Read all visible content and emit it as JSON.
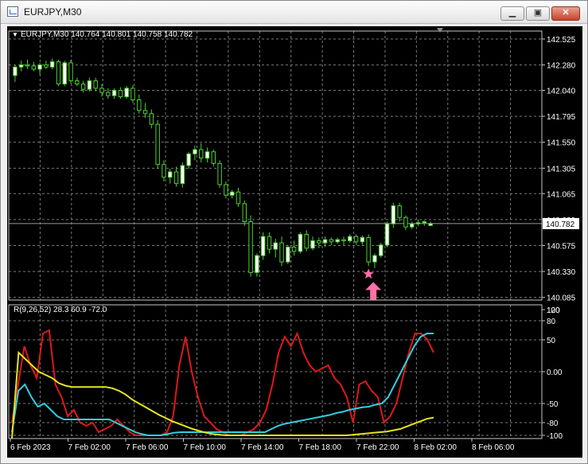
{
  "window": {
    "title": "EURJPY,M30",
    "minimize_icon": "minimize-icon",
    "maximize_icon": "maximize-icon",
    "close_icon": "close-icon"
  },
  "colors": {
    "background": "#000000",
    "grid": "#7a7a7a",
    "bull": "#ffffff",
    "bear": "#ffffff",
    "wick": "#4cd12e",
    "rsi_fast": "#e01818",
    "rsi_mid": "#2fd0e0",
    "rsi_slow": "#e6e61e",
    "signal": "#ff6fa8",
    "price_line": "#9a9a9a"
  },
  "chart_data": [
    {
      "type": "candlestick",
      "title": "EURJPY,M30  140.764 140.801 140.758 140.782",
      "symbol_label": "EURJPY,M30",
      "ohlc_label": "140.764 140.801 140.758 140.782",
      "ylim": [
        140.06,
        142.6
      ],
      "y_ticks": [
        "142.525",
        "142.280",
        "142.040",
        "141.795",
        "141.550",
        "141.305",
        "141.065",
        "140.820",
        "140.575",
        "140.330",
        "140.085"
      ],
      "current_price": "140.782",
      "current_value": 140.782,
      "x_labels": [
        "6 Feb 2023",
        "7 Feb 02:00",
        "7 Feb 06:00",
        "7 Feb 10:00",
        "7 Feb 14:00",
        "7 Feb 18:00",
        "7 Feb 22:00",
        "8 Feb 02:00",
        "8 Feb 06:00"
      ],
      "candles": [
        [
          142.18,
          142.28,
          142.12,
          142.26
        ],
        [
          142.26,
          142.32,
          142.22,
          142.28
        ],
        [
          142.28,
          142.33,
          142.24,
          142.27
        ],
        [
          142.27,
          142.31,
          142.22,
          142.24
        ],
        [
          142.24,
          142.3,
          142.19,
          142.28
        ],
        [
          142.28,
          142.32,
          142.24,
          142.26
        ],
        [
          142.26,
          142.34,
          142.24,
          142.31
        ],
        [
          142.31,
          142.33,
          142.08,
          142.1
        ],
        [
          142.1,
          142.32,
          142.08,
          142.3
        ],
        [
          142.3,
          142.33,
          142.1,
          142.13
        ],
        [
          142.13,
          142.16,
          142.08,
          142.1
        ],
        [
          142.1,
          142.13,
          142.02,
          142.05
        ],
        [
          142.05,
          142.16,
          142.03,
          142.13
        ],
        [
          142.13,
          142.16,
          142.03,
          142.06
        ],
        [
          142.06,
          142.1,
          141.98,
          142.02
        ],
        [
          142.02,
          142.06,
          141.96,
          141.99
        ],
        [
          141.99,
          142.06,
          141.96,
          142.04
        ],
        [
          142.04,
          142.07,
          141.96,
          141.98
        ],
        [
          141.98,
          142.08,
          141.96,
          142.06
        ],
        [
          142.06,
          142.09,
          141.92,
          141.95
        ],
        [
          141.95,
          142.0,
          141.82,
          141.85
        ],
        [
          141.85,
          141.92,
          141.78,
          141.82
        ],
        [
          141.82,
          141.86,
          141.68,
          141.72
        ],
        [
          141.72,
          141.76,
          141.3,
          141.34
        ],
        [
          141.34,
          141.38,
          141.18,
          141.22
        ],
        [
          141.22,
          141.3,
          141.16,
          141.27
        ],
        [
          141.27,
          141.32,
          141.13,
          141.16
        ],
        [
          141.16,
          141.36,
          141.12,
          141.33
        ],
        [
          141.33,
          141.46,
          141.3,
          141.44
        ],
        [
          141.44,
          141.52,
          141.38,
          141.48
        ],
        [
          141.48,
          141.54,
          141.36,
          141.4
        ],
        [
          141.4,
          141.5,
          141.36,
          141.46
        ],
        [
          141.46,
          141.48,
          141.32,
          141.35
        ],
        [
          141.35,
          141.38,
          141.12,
          141.15
        ],
        [
          141.15,
          141.18,
          141.02,
          141.05
        ],
        [
          141.05,
          141.1,
          141.02,
          141.08
        ],
        [
          141.08,
          141.12,
          140.94,
          140.97
        ],
        [
          140.97,
          141.0,
          140.76,
          140.8
        ],
        [
          140.8,
          140.86,
          140.28,
          140.32
        ],
        [
          140.32,
          140.5,
          140.28,
          140.48
        ],
        [
          140.48,
          140.7,
          140.44,
          140.66
        ],
        [
          140.66,
          140.7,
          140.5,
          140.54
        ],
        [
          140.54,
          140.64,
          140.46,
          140.6
        ],
        [
          140.6,
          140.66,
          140.38,
          140.42
        ],
        [
          140.42,
          140.58,
          140.4,
          140.56
        ],
        [
          140.56,
          140.62,
          140.48,
          140.52
        ],
        [
          140.52,
          140.7,
          140.5,
          140.68
        ],
        [
          140.68,
          140.72,
          140.52,
          140.55
        ],
        [
          140.55,
          140.66,
          140.53,
          140.62
        ],
        [
          140.62,
          140.65,
          140.55,
          140.6
        ],
        [
          140.6,
          140.66,
          140.56,
          140.63
        ],
        [
          140.63,
          140.65,
          140.58,
          140.61
        ],
        [
          140.61,
          140.65,
          140.59,
          140.63
        ],
        [
          140.63,
          140.66,
          140.58,
          140.62
        ],
        [
          140.62,
          140.68,
          140.6,
          140.66
        ],
        [
          140.66,
          140.68,
          140.58,
          140.61
        ],
        [
          140.61,
          140.67,
          140.58,
          140.65
        ],
        [
          140.65,
          140.68,
          140.38,
          140.42
        ],
        [
          140.42,
          140.5,
          140.36,
          140.48
        ],
        [
          140.48,
          140.6,
          140.46,
          140.58
        ],
        [
          140.58,
          140.8,
          140.56,
          140.78
        ],
        [
          140.78,
          140.98,
          140.74,
          140.95
        ],
        [
          140.95,
          140.98,
          140.8,
          140.84
        ],
        [
          140.84,
          140.86,
          140.72,
          140.75
        ],
        [
          140.75,
          140.8,
          140.73,
          140.78
        ],
        [
          140.78,
          140.82,
          140.76,
          140.79
        ],
        [
          140.79,
          140.81,
          140.76,
          140.8
        ],
        [
          140.764,
          140.801,
          140.758,
          140.782
        ]
      ],
      "signal_index": 57
    },
    {
      "type": "line",
      "indicator_label": "R(9,26,52) 28.3 60.9 -72.0",
      "ylim": [
        -105,
        105
      ],
      "y_ticks": [
        "120",
        "100",
        "80",
        "50",
        "0.00",
        "-50",
        "-80",
        "-100"
      ],
      "y_tick_values": [
        118,
        100,
        80,
        50,
        0,
        -50,
        -80,
        -100
      ],
      "series": [
        {
          "values": [
            -80,
            -20,
            40,
            10,
            -10,
            60,
            65,
            -20,
            -40,
            -70,
            -60,
            -80,
            -85,
            -80,
            -95,
            -90,
            -85,
            -75,
            -85,
            -95,
            -100,
            -100,
            -100,
            -100,
            -100,
            -95,
            -70,
            10,
            55,
            0,
            -40,
            -70,
            -80,
            -90,
            -95,
            -100,
            -100,
            -100,
            -95,
            -90,
            -80,
            -60,
            -20,
            30,
            55,
            40,
            60,
            30,
            10,
            0,
            5,
            10,
            -10,
            -20,
            -40,
            -80,
            -20,
            -15,
            -30,
            -40,
            -80,
            -70,
            -50,
            -10,
            30,
            60,
            60,
            50,
            30
          ]
        },
        {
          "values": [
            -95,
            -30,
            -20,
            -40,
            -55,
            -50,
            -60,
            -70,
            -75,
            -75,
            -75,
            -75,
            -75,
            -75,
            -75,
            -75,
            -80,
            -85,
            -90,
            -95,
            -98,
            -100,
            -100,
            -100,
            -98,
            -96,
            -95,
            -95,
            -95,
            -95,
            -95,
            -95,
            -95,
            -95,
            -95,
            -95,
            -95,
            -95,
            -95,
            -95,
            -90,
            -85,
            -82,
            -80,
            -78,
            -76,
            -74,
            -72,
            -70,
            -68,
            -65,
            -63,
            -60,
            -58,
            -56,
            -55,
            -52,
            -50,
            -40,
            -20,
            0,
            20,
            40,
            55,
            60,
            60
          ]
        },
        {
          "values": [
            -105,
            30,
            20,
            10,
            0,
            -5,
            -10,
            -18,
            -22,
            -24,
            -24,
            -24,
            -24,
            -24,
            -24,
            -26,
            -30,
            -36,
            -44,
            -50,
            -56,
            -62,
            -68,
            -73,
            -78,
            -82,
            -86,
            -90,
            -93,
            -96,
            -98,
            -99,
            -100,
            -100,
            -100,
            -100,
            -100,
            -100,
            -100,
            -100,
            -100,
            -100,
            -100,
            -100,
            -100,
            -100,
            -100,
            -100,
            -100,
            -100,
            -100,
            -99,
            -98,
            -97,
            -96,
            -95,
            -94,
            -92,
            -90,
            -86,
            -82,
            -78,
            -74,
            -72
          ]
        }
      ]
    }
  ]
}
